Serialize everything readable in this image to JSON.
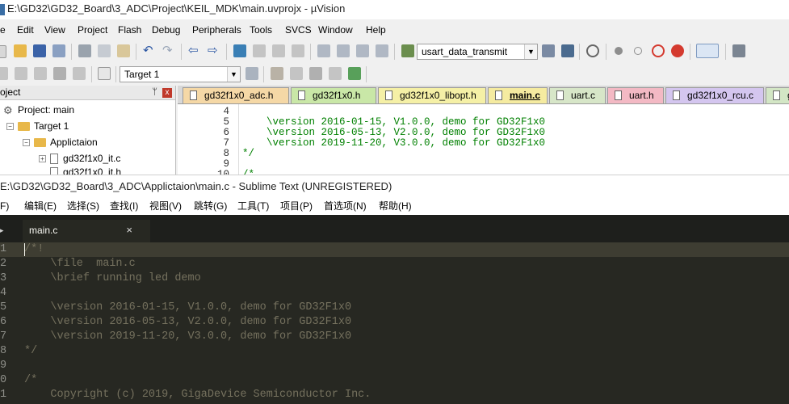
{
  "keil": {
    "title": "E:\\GD32\\GD32_Board\\3_ADC\\Project\\KEIL_MDK\\main.uvprojx - µVision",
    "menu": [
      "e",
      "Edit",
      "View",
      "Project",
      "Flash",
      "Debug",
      "Peripherals",
      "Tools",
      "SVCS",
      "Window",
      "Help"
    ],
    "toolbar_target_function": "usart_data_transmit",
    "toolbar_target": "Target 1",
    "project_panel": {
      "header": "oject",
      "pin": "ᛘ",
      "close": "x",
      "tree": [
        {
          "label": "Project: main"
        },
        {
          "label": "Target 1",
          "toggle": "−"
        },
        {
          "label": "Applictaion",
          "toggle": "−"
        },
        {
          "label": "gd32f1x0_it.c",
          "toggle": "+"
        },
        {
          "label": "gd32f1x0_it.h"
        }
      ]
    },
    "tabs": [
      {
        "label": "gd32f1x0_adc.h",
        "color": "#f5d8a6"
      },
      {
        "label": "gd32f1x0.h",
        "color": "#c9e7a7"
      },
      {
        "label": "gd32f1x0_libopt.h",
        "color": "#f5f0a6"
      },
      {
        "label": "main.c",
        "color": "#f5eba0"
      },
      {
        "label": "uart.c",
        "color": "#d7e6c8"
      },
      {
        "label": "uart.h",
        "color": "#f3b9c4"
      },
      {
        "label": "gd32f1x0_rcu.c",
        "color": "#d4c6ef"
      },
      {
        "label": "g",
        "color": "#d3e6c5"
      }
    ],
    "editor_lines": [
      {
        "num": "4",
        "code": ""
      },
      {
        "num": "5",
        "code": "    \\version 2016-01-15, V1.0.0, demo for GD32F1x0"
      },
      {
        "num": "6",
        "code": "    \\version 2016-05-13, V2.0.0, demo for GD32F1x0"
      },
      {
        "num": "7",
        "code": "    \\version 2019-11-20, V3.0.0, demo for GD32F1x0"
      },
      {
        "num": "8",
        "code": "*/"
      },
      {
        "num": "9",
        "code": ""
      },
      {
        "num": "10",
        "code": "/*"
      }
    ]
  },
  "sublime": {
    "title": "E:\\GD32\\GD32_Board\\3_ADC\\Applictaion\\main.c - Sublime Text (UNREGISTERED)",
    "menu": [
      "(F)",
      "编辑(E)",
      "选择(S)",
      "查找(I)",
      "视图(V)",
      "跳转(G)",
      "工具(T)",
      "项目(P)",
      "首选项(N)",
      "帮助(H)"
    ],
    "tab": {
      "label": "main.c",
      "close": "×"
    },
    "lines": [
      {
        "num": "1",
        "code": "/*!"
      },
      {
        "num": "2",
        "code": "    \\file  main.c"
      },
      {
        "num": "3",
        "code": "    \\brief running led demo"
      },
      {
        "num": "4",
        "code": ""
      },
      {
        "num": "5",
        "code": "    \\version 2016-01-15, V1.0.0, demo for GD32F1x0"
      },
      {
        "num": "6",
        "code": "    \\version 2016-05-13, V2.0.0, demo for GD32F1x0"
      },
      {
        "num": "7",
        "code": "    \\version 2019-11-20, V3.0.0, demo for GD32F1x0"
      },
      {
        "num": "8",
        "code": "*/"
      },
      {
        "num": "9",
        "code": ""
      },
      {
        "num": "0",
        "code": "/*"
      },
      {
        "num": "1",
        "code": "    Copyright (c) 2019, GigaDevice Semiconductor Inc."
      }
    ]
  }
}
